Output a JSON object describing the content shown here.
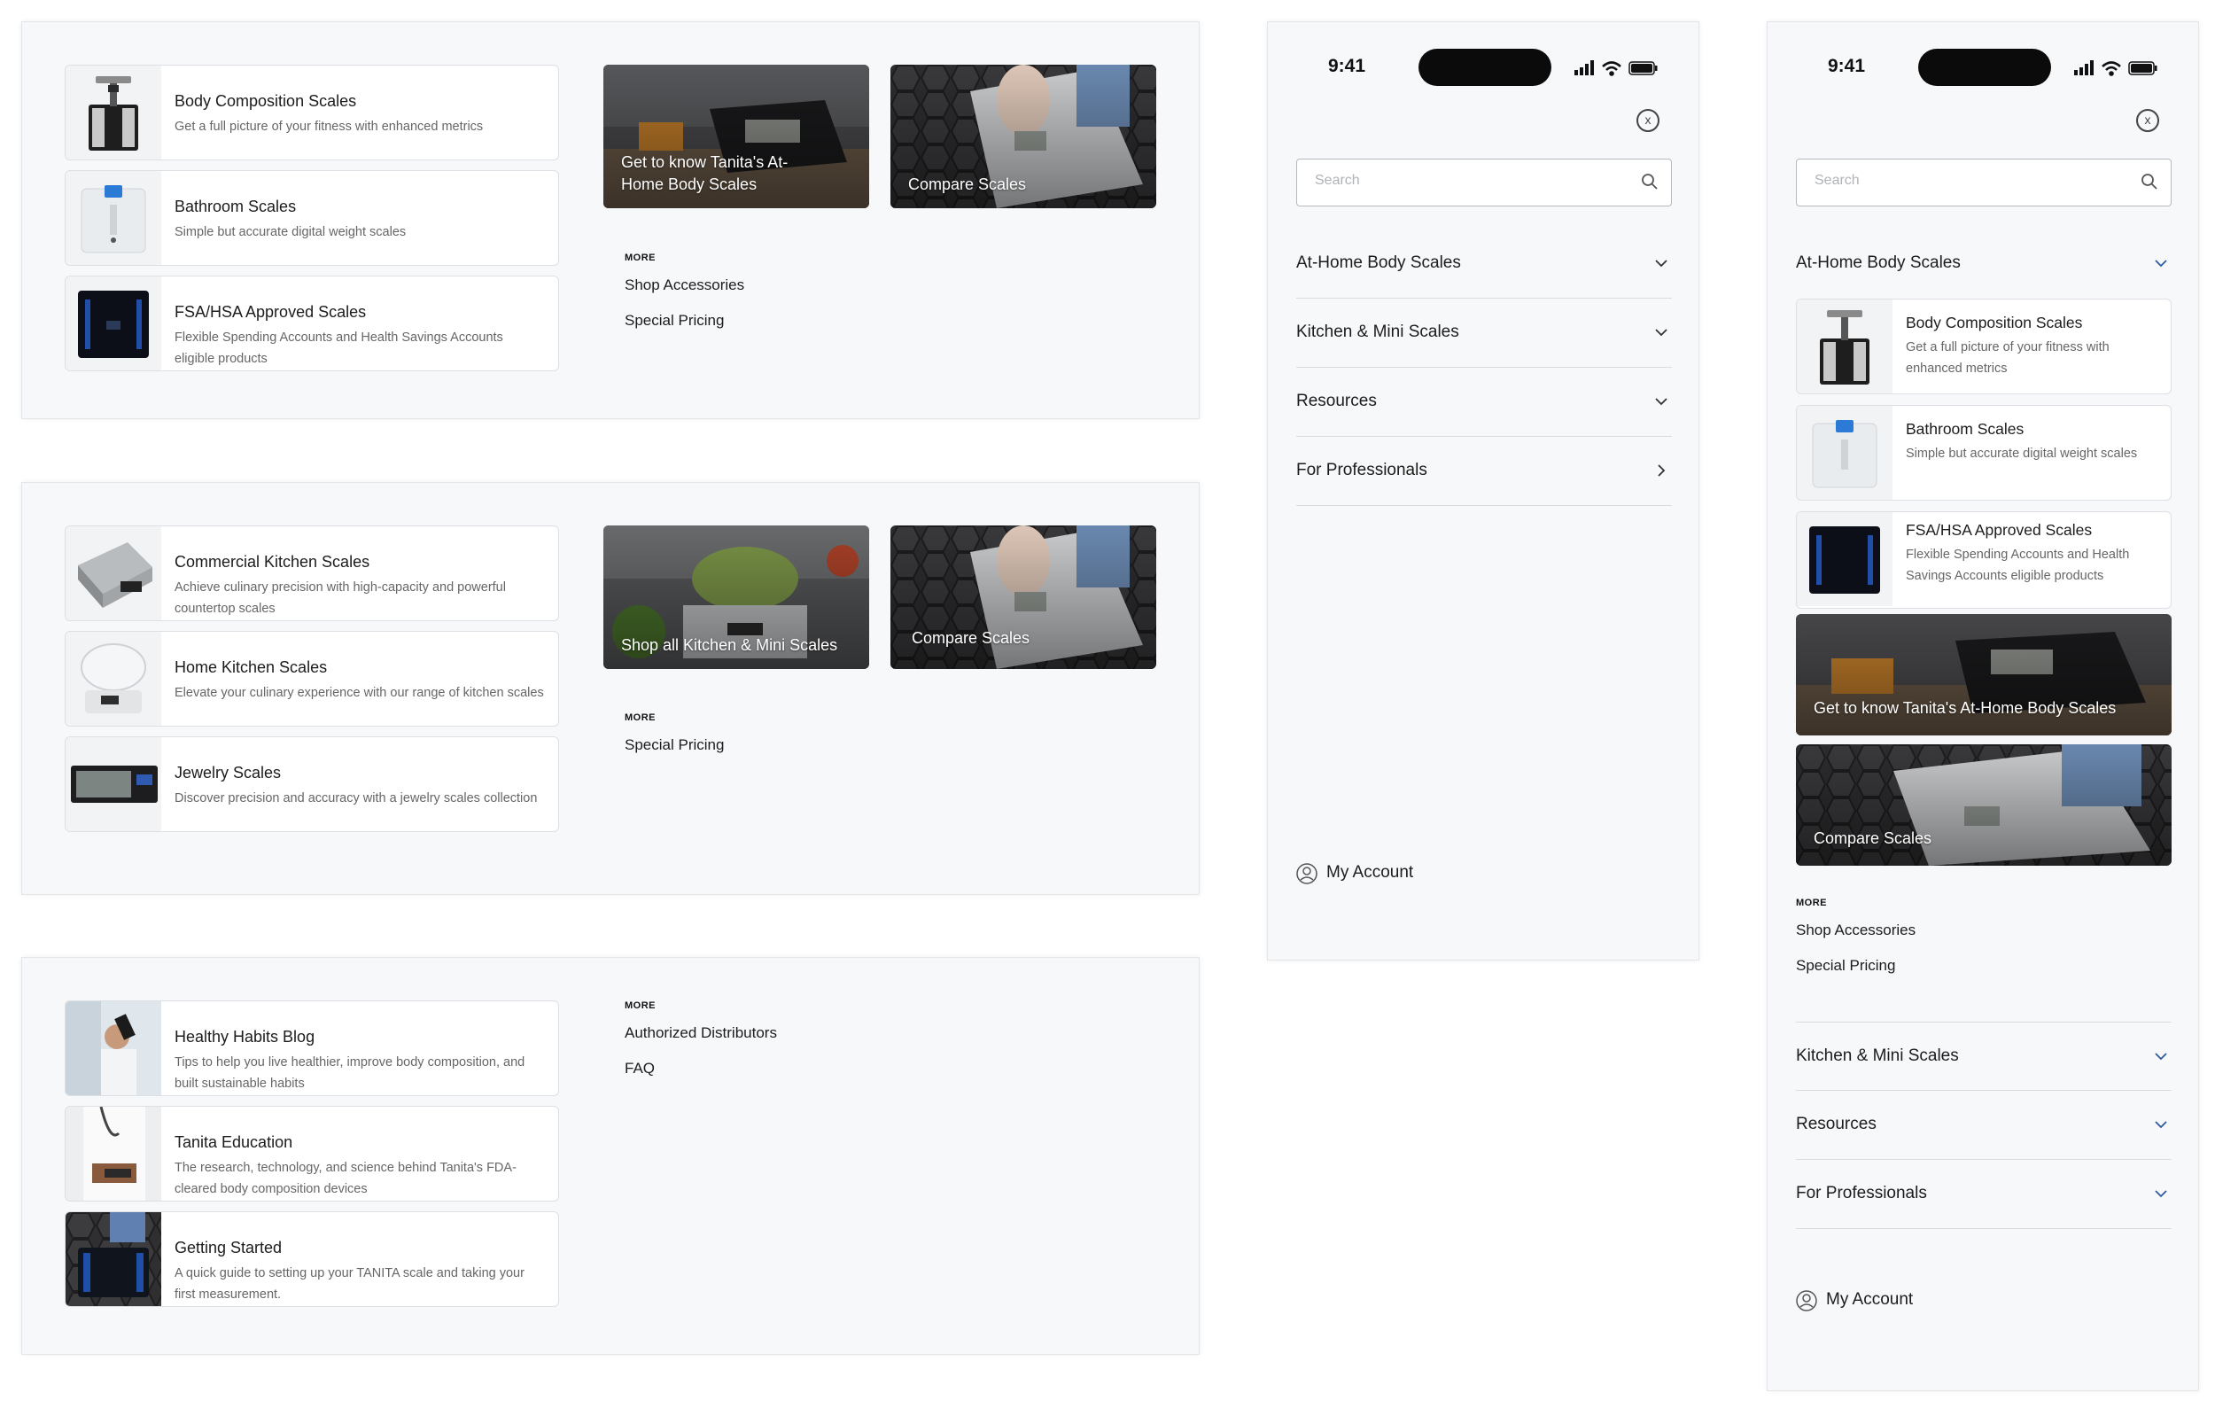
{
  "colors": {
    "panel_bg": "#f7f8fa",
    "card_border": "#dcdfe3",
    "text": "#1c1c1c",
    "muted": "#666666",
    "tile_dark": "#3b3b3d",
    "chevron_blue": "#2c5aa0"
  },
  "body_scales_menu": {
    "cards": [
      {
        "title": "Body Composition Scales",
        "desc": "Get a full picture of your fitness with enhanced metrics"
      },
      {
        "title": "Bathroom Scales",
        "desc": "Simple but accurate digital weight scales"
      },
      {
        "title": "FSA/HSA Approved Scales",
        "desc": "Flexible Spending Accounts and Health Savings Accounts eligible products"
      }
    ],
    "tiles": [
      "Get to know Tanita's At-Home Body Scales",
      "Compare Scales"
    ],
    "more_heading": "MORE",
    "more_links": [
      "Shop Accessories",
      "Special Pricing"
    ]
  },
  "kitchen_menu": {
    "cards": [
      {
        "title": "Commercial Kitchen Scales",
        "desc": "Achieve culinary precision with high-capacity and powerful countertop scales"
      },
      {
        "title": "Home Kitchen Scales",
        "desc": "Elevate your culinary experience with our range of kitchen scales"
      },
      {
        "title": "Jewelry Scales",
        "desc": "Discover precision and accuracy with a jewelry scales collection"
      }
    ],
    "tiles": [
      "Shop all Kitchen & Mini Scales",
      "Compare Scales"
    ],
    "more_heading": "MORE",
    "more_links": [
      "Special Pricing"
    ]
  },
  "resources_menu": {
    "cards": [
      {
        "title": "Healthy Habits Blog",
        "desc": "Tips to help you live healthier, improve body composition, and built sustainable habits"
      },
      {
        "title": "Tanita Education",
        "desc": "The research, technology, and science behind Tanita's FDA-cleared body composition devices"
      },
      {
        "title": "Getting Started",
        "desc": "A quick guide to setting up your TANITA scale and taking your first measurement."
      }
    ],
    "more_heading": "MORE",
    "more_links": [
      "Authorized Distributors",
      "FAQ"
    ]
  },
  "mobile_collapsed": {
    "time": "9:41",
    "close_label": "x",
    "search_placeholder": "Search",
    "nav": [
      "At-Home Body Scales",
      "Kitchen & Mini Scales",
      "Resources",
      "For Professionals"
    ],
    "account": "My Account"
  },
  "mobile_expanded": {
    "time": "9:41",
    "close_label": "x",
    "search_placeholder": "Search",
    "open_section": "At-Home Body Scales",
    "cards": [
      {
        "title": "Body Composition Scales",
        "desc": "Get a full picture of your fitness with enhanced metrics"
      },
      {
        "title": "Bathroom Scales",
        "desc": "Simple but accurate digital weight scales"
      },
      {
        "title": "FSA/HSA Approved Scales",
        "desc": "Flexible Spending Accounts and Health Savings Accounts eligible products"
      }
    ],
    "tiles": [
      "Get to know Tanita's At-Home Body Scales",
      "Compare Scales"
    ],
    "more_heading": "MORE",
    "more_links": [
      "Shop Accessories",
      "Special Pricing"
    ],
    "nav": [
      "Kitchen & Mini Scales",
      "Resources",
      "For Professionals"
    ],
    "account": "My Account"
  }
}
